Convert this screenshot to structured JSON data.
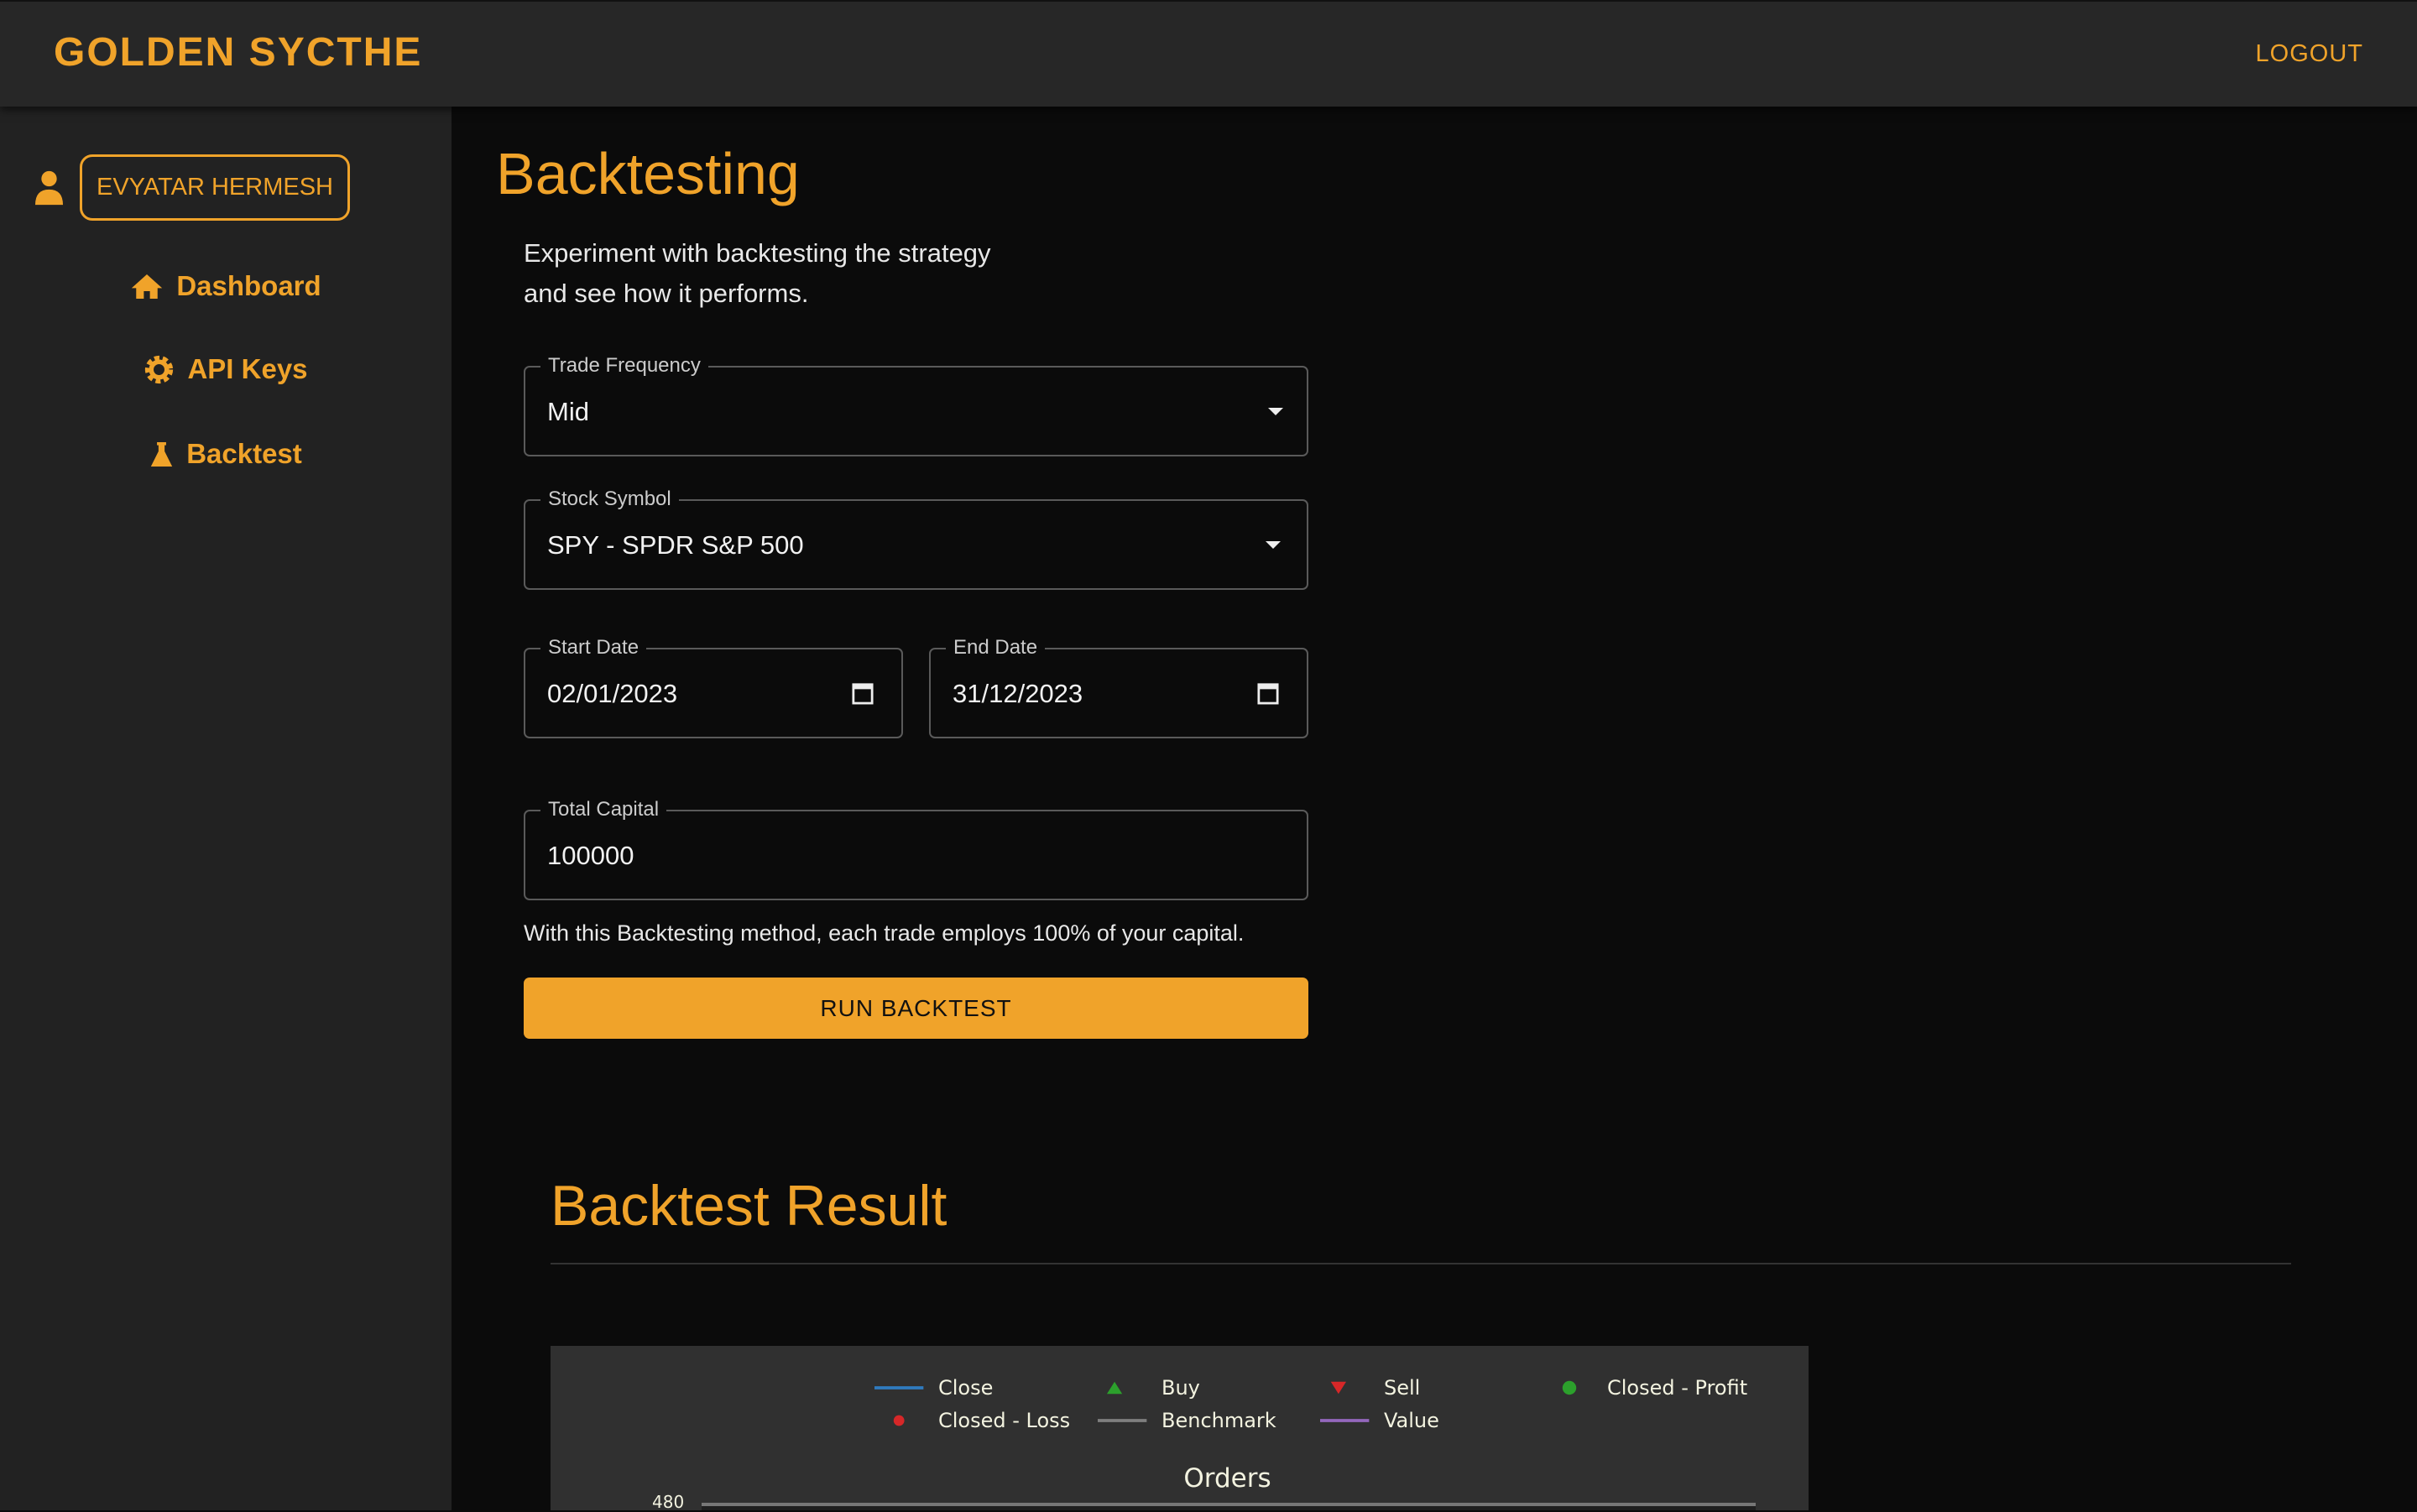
{
  "header": {
    "brand": "GOLDEN SYCTHE",
    "logout": "LOGOUT"
  },
  "sidebar": {
    "user": "EVYATAR HERMESH",
    "items": [
      {
        "label": "Dashboard",
        "icon": "home-icon"
      },
      {
        "label": "API Keys",
        "icon": "gear-icon"
      },
      {
        "label": "Backtest",
        "icon": "flask-icon"
      }
    ]
  },
  "main": {
    "title": "Backtesting",
    "intro_line1": "Experiment with backtesting the strategy",
    "intro_line2": "and see how it performs.",
    "trade_frequency": {
      "label": "Trade Frequency",
      "value": "Mid"
    },
    "stock_symbol": {
      "label": "Stock Symbol",
      "value": "SPY - SPDR S&P 500"
    },
    "start_date": {
      "label": "Start Date",
      "value": "02/01/2023"
    },
    "end_date": {
      "label": "End Date",
      "value": "31/12/2023"
    },
    "total_capital": {
      "label": "Total Capital",
      "value": "100000"
    },
    "note": "With this Backtesting method, each trade employs 100% of your capital.",
    "run_button": "RUN BACKTEST",
    "result_title": "Backtest Result"
  },
  "chart": {
    "title": "Orders",
    "y_tick_top": "480",
    "legend": [
      "Close",
      "Buy",
      "Sell",
      "Closed - Profit",
      "Closed - Loss",
      "Benchmark",
      "Value"
    ],
    "colors": {
      "close": "#2f7bbf",
      "buy": "#2ca02c",
      "sell": "#d62728",
      "profit": "#2ca02c",
      "loss": "#d62728",
      "benchmark": "#7f7f7f",
      "value": "#9467bd",
      "accent": "#f0a32a"
    }
  }
}
